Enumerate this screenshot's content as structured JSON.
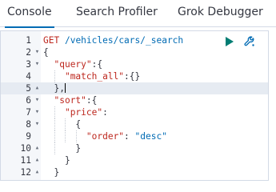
{
  "tabs": [
    {
      "label": "Console",
      "active": true
    },
    {
      "label": "Search Profiler",
      "active": false
    },
    {
      "label": "Grok Debugger",
      "active": false
    }
  ],
  "editor": {
    "active_line": 5,
    "lines": [
      {
        "num": "1",
        "fold": ""
      },
      {
        "num": "2",
        "fold": "▾"
      },
      {
        "num": "3",
        "fold": "▾"
      },
      {
        "num": "4",
        "fold": ""
      },
      {
        "num": "5",
        "fold": "▴"
      },
      {
        "num": "6",
        "fold": "▾"
      },
      {
        "num": "7",
        "fold": "▾"
      },
      {
        "num": "8",
        "fold": "▾"
      },
      {
        "num": "9",
        "fold": ""
      },
      {
        "num": "10",
        "fold": "▴"
      },
      {
        "num": "11",
        "fold": "▴"
      },
      {
        "num": "12",
        "fold": "▴"
      }
    ],
    "request": {
      "method": "GET",
      "path": "/vehicles/cars/_search"
    },
    "body": {
      "brace_open": "{",
      "query_key": "\"query\"",
      "query_open": ":{",
      "match_all_key": "\"match_all\"",
      "match_all_val": ":{}",
      "query_close": "},",
      "sort_key": "\"sort\"",
      "sort_open": ":{",
      "price_key": "\"price\"",
      "price_colon": ":",
      "price_open": "{",
      "order_key": "\"order\"",
      "order_colon": ": ",
      "order_val": "\"desc\"",
      "price_close": "}",
      "sort_close": "}",
      "brace_close": "}"
    }
  },
  "actions": {
    "run_icon": "play-icon",
    "settings_icon": "wrench-icon",
    "run_color": "#017d73",
    "settings_color": "#006bb4"
  }
}
